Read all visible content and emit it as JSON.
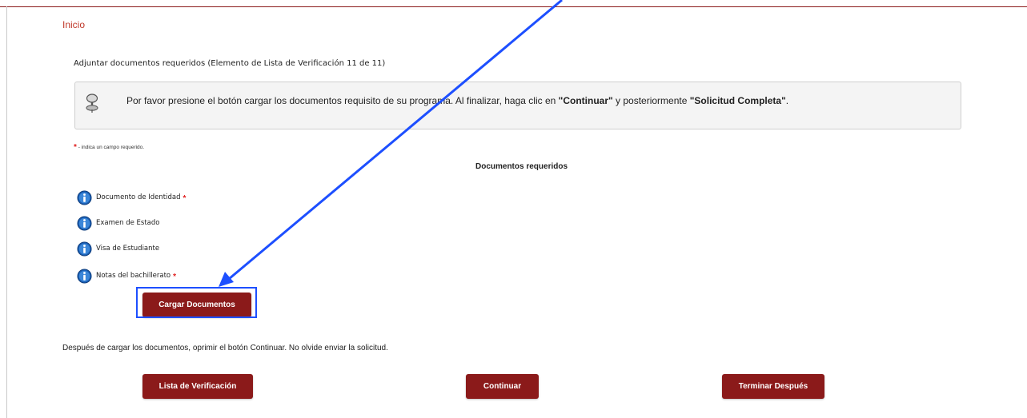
{
  "nav": {
    "home_link": "Inicio"
  },
  "section": {
    "title": "Adjuntar documentos requeridos (Elemento de Lista de Verificación 11 de 11)"
  },
  "info": {
    "text_before": "Por favor presione el botón cargar los documentos requisito de su programa. Al finalizar, haga clic en ",
    "continue_label": "\"Continuar\"",
    "text_middle": " y posteriormente ",
    "complete_label": "\"Solicitud Completa\"",
    "text_after": "."
  },
  "required_note": {
    "star": "*",
    "text": " - indica un campo requerido."
  },
  "documents": {
    "title": "Documentos requeridos",
    "items": [
      {
        "label": "Documento de Identidad",
        "required_mark": "*"
      },
      {
        "label": "Examen de Estado",
        "required_mark": ""
      },
      {
        "label": "Visa de Estudiante",
        "required_mark": ""
      },
      {
        "label": "Notas del bachillerato",
        "required_mark": "*"
      }
    ]
  },
  "upload": {
    "button_label": "Cargar Documentos"
  },
  "instructions": "Después de cargar los documentos, oprimir el botón Continuar. No olvide enviar la solicitud.",
  "actions": {
    "checklist_label": "Lista de Verificación",
    "continue_label": "Continuar",
    "finish_later_label": "Terminar Después"
  },
  "colors": {
    "brand": "#8b1a1a",
    "required_star": "#e02020",
    "annotation": "#1d4fff",
    "info_icon": "#1a5fb4"
  },
  "icons": {
    "info_panel": "pushpin-icon",
    "document_items": "info-icon"
  }
}
